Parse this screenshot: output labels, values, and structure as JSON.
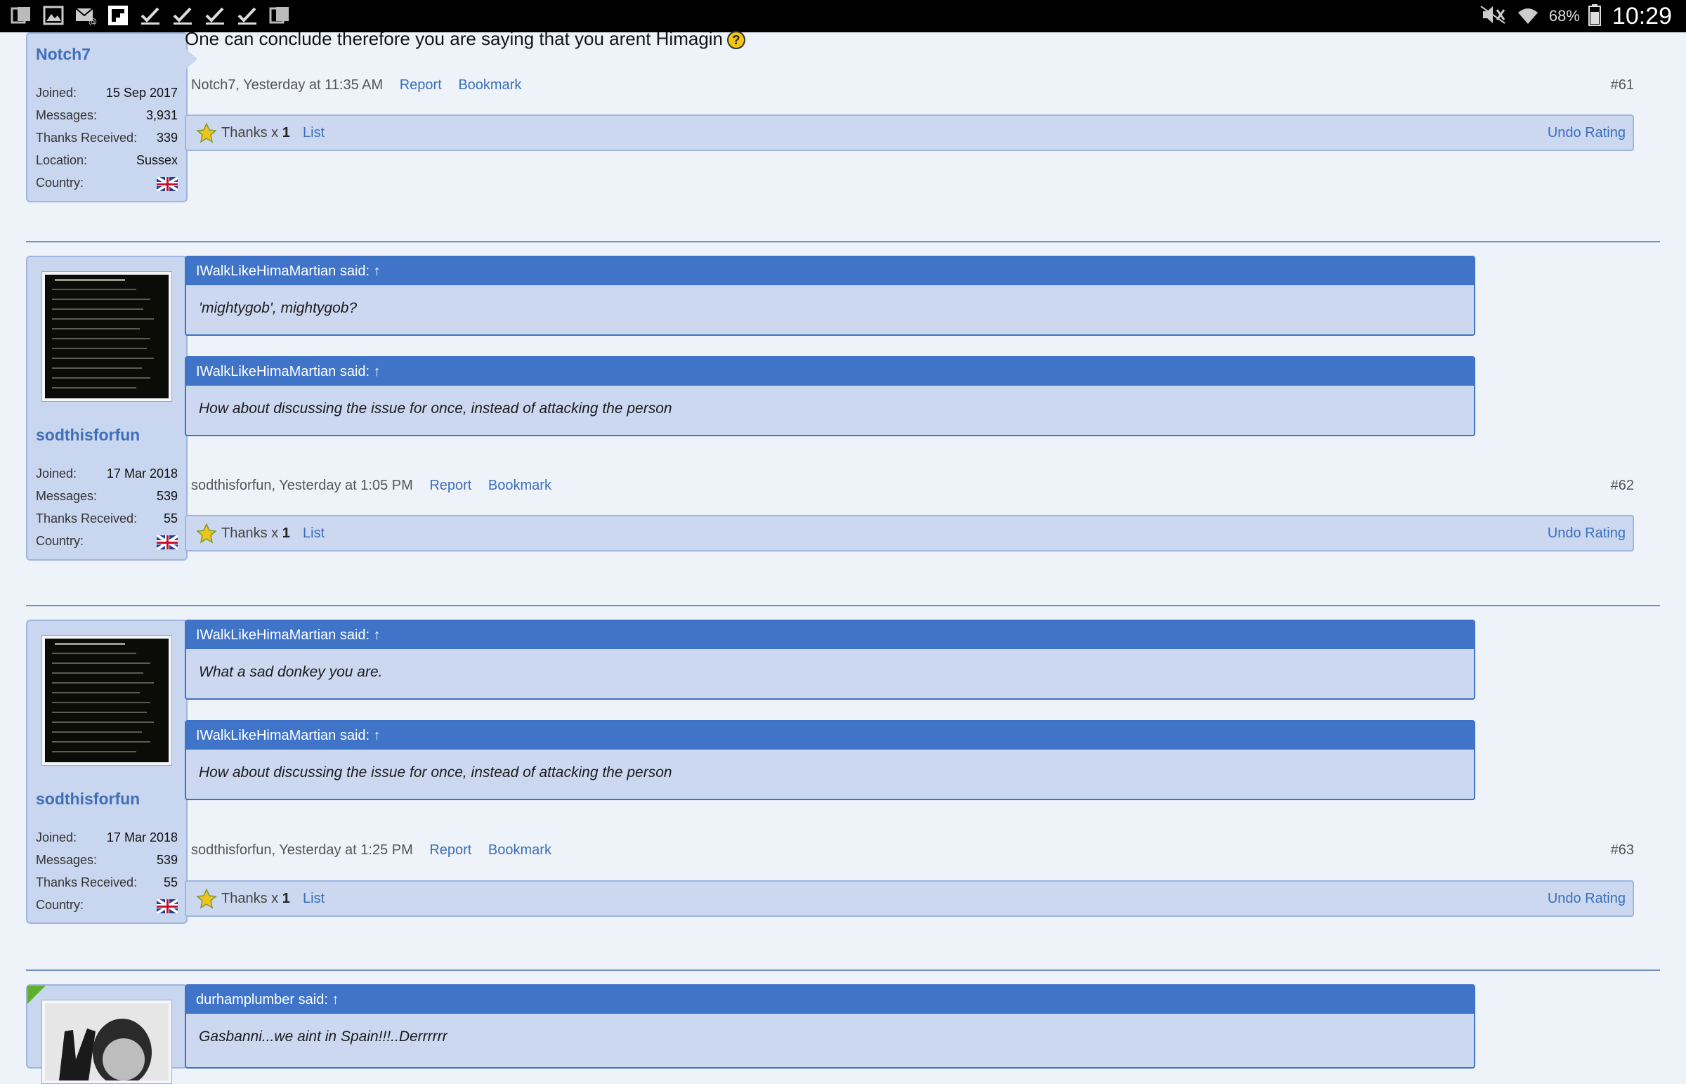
{
  "status_bar": {
    "left_icons": [
      "gallery-icon",
      "image-icon",
      "mail-icon",
      "flipboard-icon",
      "check-icon",
      "check-icon",
      "check-icon",
      "check-icon",
      "gallery-icon"
    ],
    "battery_pct": "68%",
    "time": "10:29"
  },
  "posts": [
    {
      "username": "Notch7",
      "stats": [
        {
          "label": "Joined:",
          "value": "15 Sep 2017"
        },
        {
          "label": "Messages:",
          "value": "3,931"
        },
        {
          "label": "Thanks Received:",
          "value": "339"
        },
        {
          "label": "Location:",
          "value": "Sussex"
        },
        {
          "label": "Country:",
          "value": ""
        }
      ],
      "text": "One can conclude therefore you are saying that you arent Himagin",
      "meta": "Notch7, Yesterday at 11:35 AM",
      "number": "#61"
    },
    {
      "username": "sodthisforfun",
      "stats": [
        {
          "label": "Joined:",
          "value": "17 Mar 2018"
        },
        {
          "label": "Messages:",
          "value": "539"
        },
        {
          "label": "Thanks Received:",
          "value": "55"
        },
        {
          "label": "Country:",
          "value": ""
        }
      ],
      "quotes": [
        {
          "head": "IWalkLikeHimaMartian said: ↑",
          "body": "'mightygob', mightygob?"
        },
        {
          "head": "IWalkLikeHimaMartian said: ↑",
          "body": "How about discussing the issue for once, instead of attacking the person"
        }
      ],
      "meta": "sodthisforfun, Yesterday at 1:05 PM",
      "number": "#62"
    },
    {
      "username": "sodthisforfun",
      "stats": [
        {
          "label": "Joined:",
          "value": "17 Mar 2018"
        },
        {
          "label": "Messages:",
          "value": "539"
        },
        {
          "label": "Thanks Received:",
          "value": "55"
        },
        {
          "label": "Country:",
          "value": ""
        }
      ],
      "quotes": [
        {
          "head": "IWalkLikeHimaMartian said: ↑",
          "body": "What a sad donkey you are."
        },
        {
          "head": "IWalkLikeHimaMartian said: ↑",
          "body": "How about discussing the issue for once, instead of attacking the person"
        }
      ],
      "meta": "sodthisforfun, Yesterday at 1:25 PM",
      "number": "#63"
    },
    {
      "quotes": [
        {
          "head": "durhamplumber said: ↑",
          "body": "Gasbanni...we aint in Spain!!!..Derrrrrr"
        }
      ]
    }
  ],
  "actions": {
    "report": "Report",
    "bookmark": "Bookmark"
  },
  "rating": {
    "thanks_label": "Thanks x ",
    "thanks_count": "1",
    "list": "List",
    "undo": "Undo Rating"
  }
}
